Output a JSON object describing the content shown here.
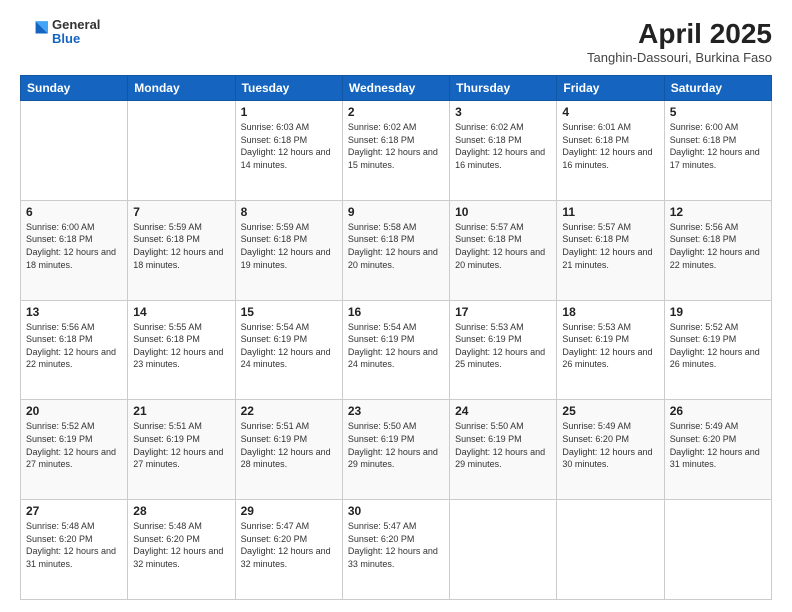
{
  "header": {
    "logo": {
      "general": "General",
      "blue": "Blue"
    },
    "title": "April 2025",
    "subtitle": "Tanghin-Dassouri, Burkina Faso"
  },
  "days_of_week": [
    "Sunday",
    "Monday",
    "Tuesday",
    "Wednesday",
    "Thursday",
    "Friday",
    "Saturday"
  ],
  "weeks": [
    [
      {
        "day": "",
        "info": ""
      },
      {
        "day": "",
        "info": ""
      },
      {
        "day": "1",
        "info": "Sunrise: 6:03 AM\nSunset: 6:18 PM\nDaylight: 12 hours and 14 minutes."
      },
      {
        "day": "2",
        "info": "Sunrise: 6:02 AM\nSunset: 6:18 PM\nDaylight: 12 hours and 15 minutes."
      },
      {
        "day": "3",
        "info": "Sunrise: 6:02 AM\nSunset: 6:18 PM\nDaylight: 12 hours and 16 minutes."
      },
      {
        "day": "4",
        "info": "Sunrise: 6:01 AM\nSunset: 6:18 PM\nDaylight: 12 hours and 16 minutes."
      },
      {
        "day": "5",
        "info": "Sunrise: 6:00 AM\nSunset: 6:18 PM\nDaylight: 12 hours and 17 minutes."
      }
    ],
    [
      {
        "day": "6",
        "info": "Sunrise: 6:00 AM\nSunset: 6:18 PM\nDaylight: 12 hours and 18 minutes."
      },
      {
        "day": "7",
        "info": "Sunrise: 5:59 AM\nSunset: 6:18 PM\nDaylight: 12 hours and 18 minutes."
      },
      {
        "day": "8",
        "info": "Sunrise: 5:59 AM\nSunset: 6:18 PM\nDaylight: 12 hours and 19 minutes."
      },
      {
        "day": "9",
        "info": "Sunrise: 5:58 AM\nSunset: 6:18 PM\nDaylight: 12 hours and 20 minutes."
      },
      {
        "day": "10",
        "info": "Sunrise: 5:57 AM\nSunset: 6:18 PM\nDaylight: 12 hours and 20 minutes."
      },
      {
        "day": "11",
        "info": "Sunrise: 5:57 AM\nSunset: 6:18 PM\nDaylight: 12 hours and 21 minutes."
      },
      {
        "day": "12",
        "info": "Sunrise: 5:56 AM\nSunset: 6:18 PM\nDaylight: 12 hours and 22 minutes."
      }
    ],
    [
      {
        "day": "13",
        "info": "Sunrise: 5:56 AM\nSunset: 6:18 PM\nDaylight: 12 hours and 22 minutes."
      },
      {
        "day": "14",
        "info": "Sunrise: 5:55 AM\nSunset: 6:18 PM\nDaylight: 12 hours and 23 minutes."
      },
      {
        "day": "15",
        "info": "Sunrise: 5:54 AM\nSunset: 6:19 PM\nDaylight: 12 hours and 24 minutes."
      },
      {
        "day": "16",
        "info": "Sunrise: 5:54 AM\nSunset: 6:19 PM\nDaylight: 12 hours and 24 minutes."
      },
      {
        "day": "17",
        "info": "Sunrise: 5:53 AM\nSunset: 6:19 PM\nDaylight: 12 hours and 25 minutes."
      },
      {
        "day": "18",
        "info": "Sunrise: 5:53 AM\nSunset: 6:19 PM\nDaylight: 12 hours and 26 minutes."
      },
      {
        "day": "19",
        "info": "Sunrise: 5:52 AM\nSunset: 6:19 PM\nDaylight: 12 hours and 26 minutes."
      }
    ],
    [
      {
        "day": "20",
        "info": "Sunrise: 5:52 AM\nSunset: 6:19 PM\nDaylight: 12 hours and 27 minutes."
      },
      {
        "day": "21",
        "info": "Sunrise: 5:51 AM\nSunset: 6:19 PM\nDaylight: 12 hours and 27 minutes."
      },
      {
        "day": "22",
        "info": "Sunrise: 5:51 AM\nSunset: 6:19 PM\nDaylight: 12 hours and 28 minutes."
      },
      {
        "day": "23",
        "info": "Sunrise: 5:50 AM\nSunset: 6:19 PM\nDaylight: 12 hours and 29 minutes."
      },
      {
        "day": "24",
        "info": "Sunrise: 5:50 AM\nSunset: 6:19 PM\nDaylight: 12 hours and 29 minutes."
      },
      {
        "day": "25",
        "info": "Sunrise: 5:49 AM\nSunset: 6:20 PM\nDaylight: 12 hours and 30 minutes."
      },
      {
        "day": "26",
        "info": "Sunrise: 5:49 AM\nSunset: 6:20 PM\nDaylight: 12 hours and 31 minutes."
      }
    ],
    [
      {
        "day": "27",
        "info": "Sunrise: 5:48 AM\nSunset: 6:20 PM\nDaylight: 12 hours and 31 minutes."
      },
      {
        "day": "28",
        "info": "Sunrise: 5:48 AM\nSunset: 6:20 PM\nDaylight: 12 hours and 32 minutes."
      },
      {
        "day": "29",
        "info": "Sunrise: 5:47 AM\nSunset: 6:20 PM\nDaylight: 12 hours and 32 minutes."
      },
      {
        "day": "30",
        "info": "Sunrise: 5:47 AM\nSunset: 6:20 PM\nDaylight: 12 hours and 33 minutes."
      },
      {
        "day": "",
        "info": ""
      },
      {
        "day": "",
        "info": ""
      },
      {
        "day": "",
        "info": ""
      }
    ]
  ]
}
